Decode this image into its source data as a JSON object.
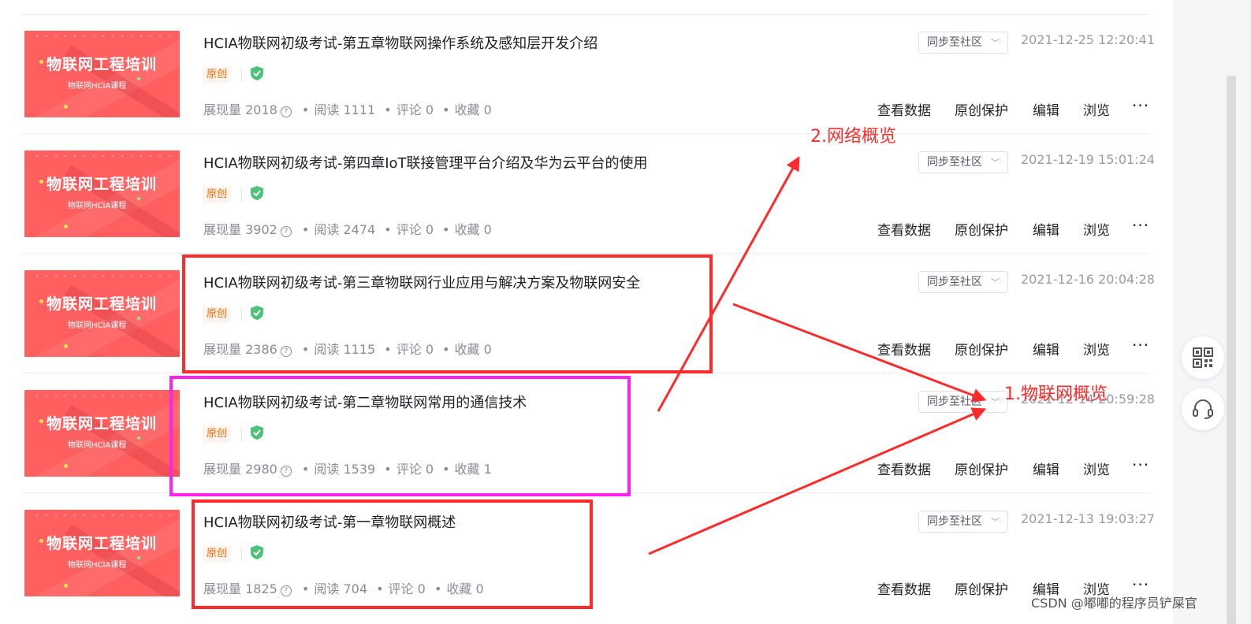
{
  "articles": [
    {
      "title": "HCIA物联网初级考试-第五章物联网操作系统及感知层开发介绍",
      "thumb_title": "物联网工程培训",
      "thumb_subtitle": "物联网HCIA课程",
      "tag": "原创",
      "stats": {
        "views_label": "展现量",
        "views": "2018",
        "reads_label": "阅读",
        "reads": "1111",
        "comments_label": "评论",
        "comments": "0",
        "favorites_label": "收藏",
        "favorites": "0"
      },
      "sync_label": "同步至社区",
      "date": "2021-12-25 12:20:41",
      "actions": {
        "data": "查看数据",
        "protect": "原创保护",
        "edit": "编辑",
        "browse": "浏览",
        "more": "···"
      }
    },
    {
      "title": "HCIA物联网初级考试-第四章IoT联接管理平台介绍及华为云平台的使用",
      "thumb_title": "物联网工程培训",
      "thumb_subtitle": "物联网HCIA课程",
      "tag": "原创",
      "stats": {
        "views_label": "展现量",
        "views": "3902",
        "reads_label": "阅读",
        "reads": "2474",
        "comments_label": "评论",
        "comments": "0",
        "favorites_label": "收藏",
        "favorites": "0"
      },
      "sync_label": "同步至社区",
      "date": "2021-12-19 15:01:24",
      "actions": {
        "data": "查看数据",
        "protect": "原创保护",
        "edit": "编辑",
        "browse": "浏览",
        "more": "···"
      }
    },
    {
      "title": "HCIA物联网初级考试-第三章物联网行业应用与解决方案及物联网安全",
      "thumb_title": "物联网工程培训",
      "thumb_subtitle": "物联网HCIA课程",
      "tag": "原创",
      "stats": {
        "views_label": "展现量",
        "views": "2386",
        "reads_label": "阅读",
        "reads": "1115",
        "comments_label": "评论",
        "comments": "0",
        "favorites_label": "收藏",
        "favorites": "0"
      },
      "sync_label": "同步至社区",
      "date": "2021-12-16 20:04:28",
      "actions": {
        "data": "查看数据",
        "protect": "原创保护",
        "edit": "编辑",
        "browse": "浏览",
        "more": "···"
      }
    },
    {
      "title": "HCIA物联网初级考试-第二章物联网常用的通信技术",
      "thumb_title": "物联网工程培训",
      "thumb_subtitle": "物联网HCIA课程",
      "tag": "原创",
      "stats": {
        "views_label": "展现量",
        "views": "2980",
        "reads_label": "阅读",
        "reads": "1539",
        "comments_label": "评论",
        "comments": "0",
        "favorites_label": "收藏",
        "favorites": "1"
      },
      "sync_label": "同步至社区",
      "date": "2021-12-14 20:59:28",
      "actions": {
        "data": "查看数据",
        "protect": "原创保护",
        "edit": "编辑",
        "browse": "浏览",
        "more": "···"
      }
    },
    {
      "title": "HCIA物联网初级考试-第一章物联网概述",
      "thumb_title": "物联网工程培训",
      "thumb_subtitle": "物联网HCIA课程",
      "tag": "原创",
      "stats": {
        "views_label": "展现量",
        "views": "1825",
        "reads_label": "阅读",
        "reads": "704",
        "comments_label": "评论",
        "comments": "0",
        "favorites_label": "收藏",
        "favorites": "0"
      },
      "sync_label": "同步至社区",
      "date": "2021-12-13 19:03:27",
      "actions": {
        "data": "查看数据",
        "protect": "原创保护",
        "edit": "编辑",
        "browse": "浏览",
        "more": "···"
      }
    }
  ],
  "annotations": {
    "label_network": "2.网络概览",
    "label_iot": "1.物联网概览",
    "color_red": "#ff2a2a",
    "color_magenta": "#ff22ee"
  },
  "side_buttons": {
    "qr_icon": "qr-code-icon",
    "support_icon": "headset-icon"
  },
  "watermark": "CSDN @嘟嘟的程序员铲屎官"
}
